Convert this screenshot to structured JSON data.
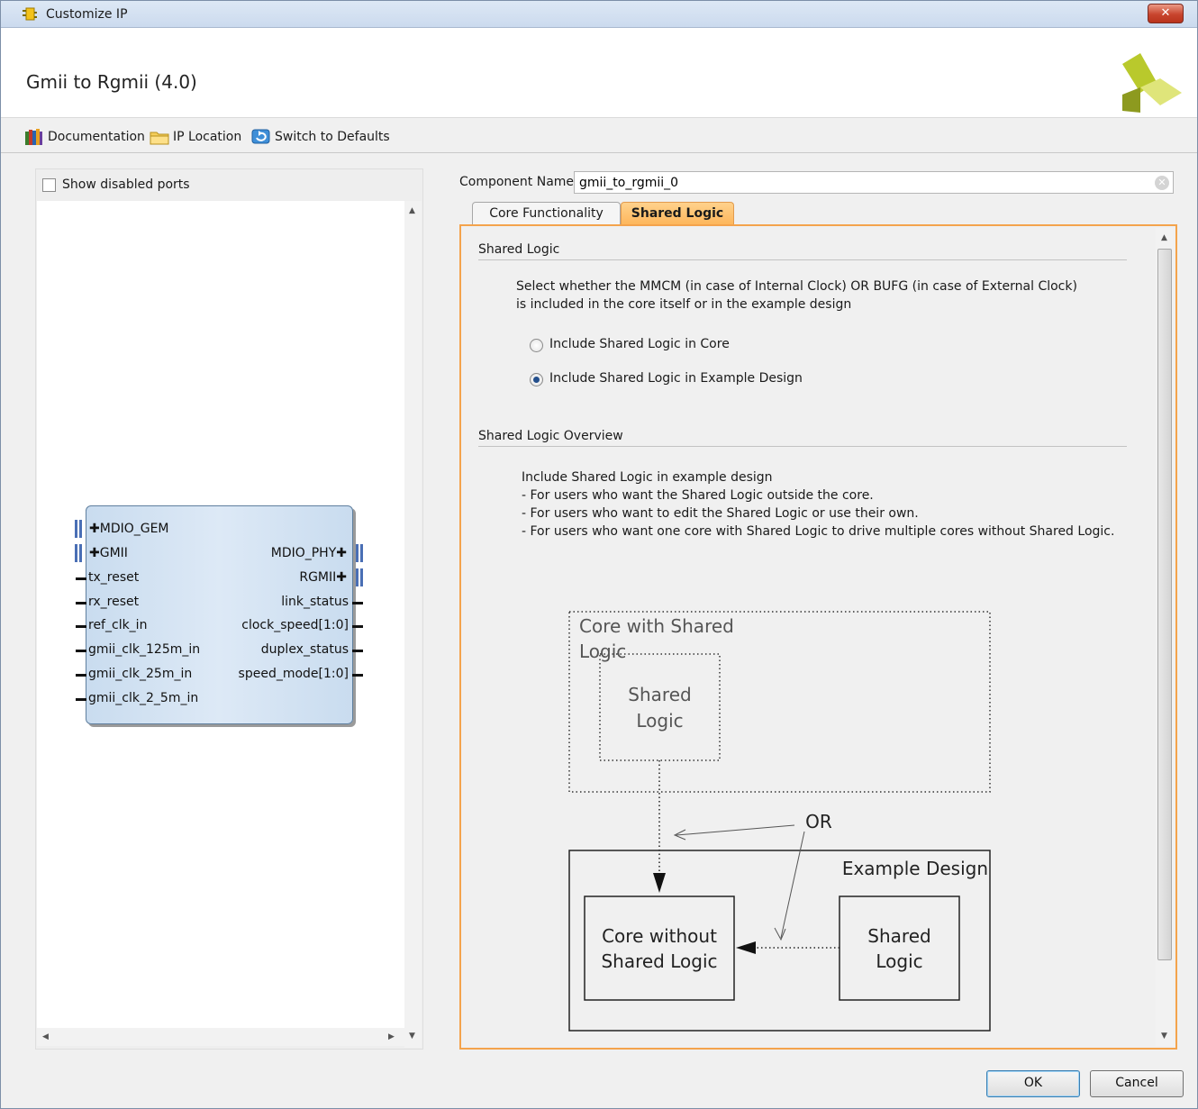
{
  "window": {
    "title": "Customize IP",
    "close_label": "✕"
  },
  "header": {
    "ip_title": "Gmii to Rgmii (4.0)"
  },
  "toolbar": {
    "documentation": "Documentation",
    "ip_location": "IP Location",
    "switch_defaults": "Switch to Defaults"
  },
  "left": {
    "show_disabled": "Show disabled ports",
    "block": {
      "left_ports": [
        "MDIO_GEM",
        "GMII",
        "tx_reset",
        "rx_reset",
        "ref_clk_in",
        "gmii_clk_125m_in",
        "gmii_clk_25m_in",
        "gmii_clk_2_5m_in"
      ],
      "right_ports": [
        "MDIO_PHY",
        "RGMII",
        "link_status",
        "clock_speed[1:0]",
        "duplex_status",
        "speed_mode[1:0]"
      ]
    }
  },
  "component": {
    "label": "Component Name",
    "value": "gmii_to_rgmii_0"
  },
  "tabs": {
    "core": "Core Functionality",
    "shared": "Shared Logic"
  },
  "shared_logic": {
    "section_title": "Shared Logic",
    "desc_line1": "Select whether the MMCM (in case of Internal Clock) OR BUFG (in case of External Clock)",
    "desc_line2": "is included in the core itself or in the example design",
    "option_core": "Include Shared Logic in Core",
    "option_example": "Include Shared Logic in Example Design",
    "selected": "option_example"
  },
  "overview": {
    "section_title": "Shared Logic Overview",
    "line1": "Include Shared Logic in example design",
    "line2": "- For users who want the Shared Logic outside the core.",
    "line3": "- For users who want to edit the Shared Logic or use their own.",
    "line4": "- For users who want one core with Shared Logic to drive multiple cores without Shared Logic."
  },
  "diagram": {
    "core_with_shared": "Core with Shared Logic",
    "shared_logic_a1": "Shared",
    "shared_logic_a2": "Logic",
    "or_label": "OR",
    "example_design": "Example Design",
    "core_without_1": "Core without",
    "core_without_2": "Shared Logic",
    "shared_logic_b1": "Shared",
    "shared_logic_b2": "Logic"
  },
  "buttons": {
    "ok": "OK",
    "cancel": "Cancel"
  },
  "colors": {
    "accent_tab": "#fdb55a",
    "panel_border": "#f4a34c",
    "block_fill": "#c9dcef",
    "bus": "#4a6fb5"
  }
}
